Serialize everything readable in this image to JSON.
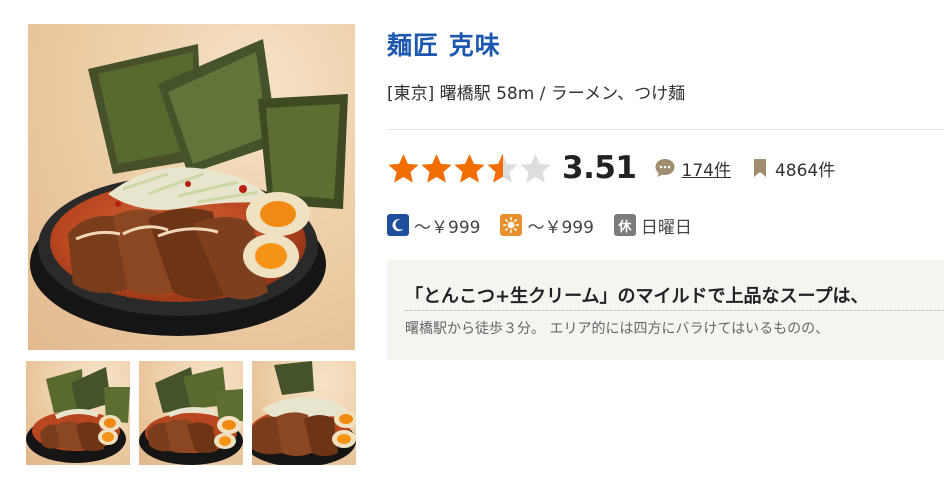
{
  "restaurant": {
    "name": "麺匠 克味",
    "area": "[東京] 曙橋駅 58m / ラーメン、つけ麺",
    "rating": {
      "score": "3.51",
      "value": 3.51,
      "max": 5
    },
    "reviews": "174件",
    "saves": "4864件",
    "price": {
      "dinner": "～￥999",
      "lunch": "～￥999"
    },
    "holiday": {
      "icon_label": "休",
      "text": "日曜日"
    },
    "pr": {
      "title": "「とんこつ+生クリーム」のマイルドで上品なスープは、",
      "body": "曙橋駅から徒歩３分。 エリア的には四方にバラけてはいるものの、"
    }
  },
  "icons": {
    "dinner": "moon-icon",
    "lunch": "sun-icon",
    "reviews": "speech-bubble-icon",
    "saves": "bookmark-icon"
  },
  "colors": {
    "name": "#1d58b0",
    "star": "#f26d00",
    "star_empty": "#dddddd",
    "dinner_icon": "#1f4f9c",
    "lunch_icon": "#e8912c",
    "pr_background": "#f6f4f0"
  }
}
